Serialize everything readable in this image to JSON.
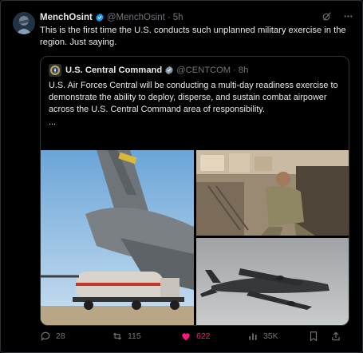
{
  "author": {
    "display_name": "MenchOsint",
    "handle": "@MenchOsint",
    "separator": "·",
    "time": "5h",
    "text": "This is the first time the U.S. conducts such unplanned military exercise in the region. Just saying."
  },
  "quoted": {
    "display_name": "U.S. Central Command",
    "handle": "@CENTCOM",
    "separator": "·",
    "time": "8h",
    "text": "U.S. Air Forces Central will be conducting a multi-day readiness exercise to demonstrate the ability to deploy, disperse, and sustain combat airpower across the U.S. Central Command area of responsibility.",
    "ellipsis": "..."
  },
  "icons": {
    "verified": "verified-badge-icon",
    "grok": "grok-icon",
    "more": "more-icon",
    "reply": "reply-icon",
    "repost": "repost-icon",
    "like": "like-icon",
    "views": "views-icon",
    "bookmark": "bookmark-icon",
    "share": "share-icon"
  },
  "metrics": {
    "replies": "28",
    "reposts": "115",
    "likes": "622",
    "views": "35K"
  },
  "colors": {
    "background": "#000000",
    "text": "#e7e9ea",
    "muted": "#71767b",
    "verified": "#1d9bf0",
    "liked": "#f91880",
    "border": "#2f3336"
  }
}
